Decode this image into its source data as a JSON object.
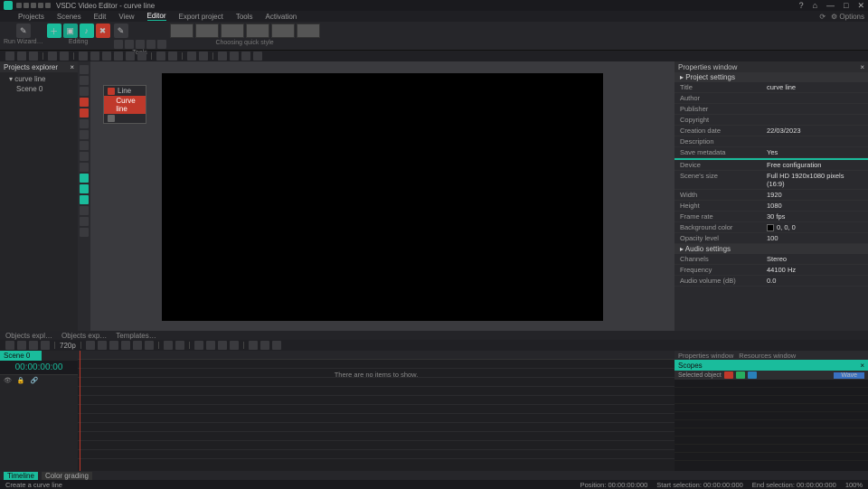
{
  "app": {
    "title": "VSDC Video Editor - curve line"
  },
  "win_controls": {
    "min": "—",
    "max": "□",
    "close": "✕",
    "help": "?",
    "home": "⌂"
  },
  "menu": {
    "items": [
      "Projects",
      "Scenes",
      "Edit",
      "View",
      "Editor",
      "Export project",
      "Tools",
      "Activation"
    ],
    "active_index": 4,
    "right": {
      "convert": "⟳",
      "options": "⚙ Options"
    }
  },
  "ribbon": {
    "wizard": "Run Wizard…",
    "add_object": "Add object",
    "video_effects": "Video effects",
    "audio_effects": "Audio effects",
    "text_effects": "Text effects",
    "editing_label": "Editing",
    "tools_label": "Tools",
    "style_label": "Choosing quick style"
  },
  "explorer": {
    "title": "Projects explorer",
    "root": "curve line",
    "scene": "Scene 0"
  },
  "context_menu": {
    "items": [
      {
        "label": "Line",
        "selected": false
      },
      {
        "label": "Curve line",
        "selected": true
      },
      {
        "label": "",
        "selected": false
      }
    ]
  },
  "properties": {
    "panel_title": "Properties window",
    "section_project": "Project settings",
    "rows_general": [
      {
        "k": "Title",
        "v": "curve line"
      },
      {
        "k": "Author",
        "v": ""
      },
      {
        "k": "Publisher",
        "v": ""
      },
      {
        "k": "Copyright",
        "v": ""
      },
      {
        "k": "Creation date",
        "v": "22/03/2023"
      },
      {
        "k": "Description",
        "v": ""
      },
      {
        "k": "Save metadata",
        "v": "Yes"
      }
    ],
    "teal_header": "",
    "rows_device": [
      {
        "k": "Device",
        "v": "Free configuration"
      },
      {
        "k": "Scene's size",
        "v": "Full HD 1920x1080 pixels (16:9)"
      },
      {
        "k": "Width",
        "v": "1920"
      },
      {
        "k": "Height",
        "v": "1080"
      },
      {
        "k": "Frame rate",
        "v": "30 fps"
      },
      {
        "k": "Background color",
        "v": "0, 0, 0"
      },
      {
        "k": "Opacity level",
        "v": "100"
      }
    ],
    "section_audio": "Audio settings",
    "rows_audio": [
      {
        "k": "Channels",
        "v": "Stereo"
      },
      {
        "k": "Frequency",
        "v": "44100 Hz"
      },
      {
        "k": "Audio volume (dB)",
        "v": "0.0"
      }
    ]
  },
  "mid_tabs": {
    "a": "Objects expl…",
    "b": "Objects exp…",
    "c": "Templates…"
  },
  "playback": {
    "res": "720p",
    "timecode": "00:00:00:00"
  },
  "timeline": {
    "scene_tab": "Scene 0",
    "empty": "There are no items to show.",
    "track_labels": [
      "",
      "",
      ""
    ]
  },
  "scopes": {
    "tabs": {
      "a": "Properties window",
      "b": "Resources window"
    },
    "title": "Scopes",
    "selected_label": "Selected object",
    "mode": "Wave"
  },
  "bottom_tabs": {
    "a": "Timeline",
    "b": "Color grading"
  },
  "status": {
    "left": "Create a curve line",
    "position_label": "Position:",
    "position": "00:00:00:000",
    "start_label": "Start selection:",
    "start": "00:00:00:000",
    "end_label": "End selection:",
    "end": "00:00:00:000",
    "zoom": "100%"
  }
}
